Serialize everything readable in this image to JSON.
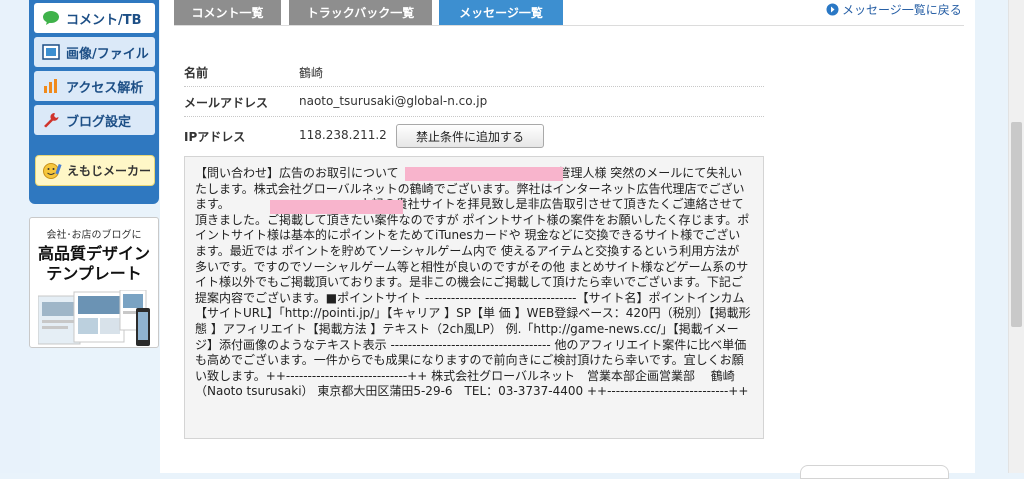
{
  "sidebar": {
    "items": [
      {
        "label": "コメント/TB",
        "icon": "comment-bubble-icon",
        "active": true
      },
      {
        "label": "画像/ファイル",
        "icon": "image-icon",
        "active": false
      },
      {
        "label": "アクセス解析",
        "icon": "bar-chart-icon",
        "active": false
      },
      {
        "label": "ブログ設定",
        "icon": "wrench-icon",
        "active": false
      }
    ],
    "emoji_label": "えもじメーカー"
  },
  "promo": {
    "line1": "会社･お店のブログに",
    "line2": "高品質デザイン",
    "line3": "テンプレート"
  },
  "tabs": [
    {
      "label": "コメント一覧",
      "active": false
    },
    {
      "label": "トラックバック一覧",
      "active": false
    },
    {
      "label": "メッセージ一覧",
      "active": true
    }
  ],
  "back_link": "メッセージ一覧に戻る",
  "details": {
    "name_label": "名前",
    "name_value": "鶴崎",
    "email_label": "メールアドレス",
    "email_value": "naoto_tsurusaki@global-n.co.jp",
    "ip_label": "IPアドレス",
    "ip_value": "118.238.211.2",
    "ban_button": "禁止条件に追加する"
  },
  "message": "【問い合わせ】広告のお取引について　　　　　　　　　　　　　 管理人様 突然のメールにて失礼いたします。株式会社グローバルネットの鶴崎でございます。弊社はインターネット広告代理店でございます。　　　　　　　　　　　 上記の貴社サイトを拝見致し是非広告取引させて頂きたくご連絡させて頂きました。ご掲載して頂きたい案件なのですが ポイントサイト様の案件をお願いしたく存じます。ポイントサイト様は基本的にポイントをためてiTunesカードや 現金などに交換できるサイト様でございます。最近では ポイントを貯めてソーシャルゲーム内で 使えるアイテムと交換するという利用方法が多いです。ですのでソーシャルゲーム等と相性が良いのですがその他 まとめサイト様などゲーム系のサイト様以外でもご掲載頂いております。是非この機会にご掲載して頂けたら幸いでございます。下記ご提案内容でございます。■ポイントサイト -----------------------------------【サイト名】ポイントインカム【サイトURL】「http://pointi.jp/」【キャリア 】SP【単 価 】WEB登録ベース：420円（税別）【掲載形態 】アフィリエイト【掲載方法 】テキスト（2ch風LP） 例.「http://game-news.cc/」【掲載イメージ】添付画像のようなテキスト表示 ------------------------------------- 他のアフィリエイト案件に比べ単価も高めでございます。一件からでも成果になりますので前向きにご検討頂けたら幸いです。宜しくお願い致します。++----------------------------++ 株式会社グローバルネット　営業本部企画営業部　 鶴崎 （Naoto tsurusaki） 東京都大田区蒲田5-29-6　TEL：03-3737-4400 ++----------------------------++",
  "colors": {
    "sidebar_blue": "#2f78c0",
    "tab_active": "#3d8fd0",
    "tab_inactive": "#8e8e8e",
    "redaction_pink": "#f8b4cc"
  }
}
